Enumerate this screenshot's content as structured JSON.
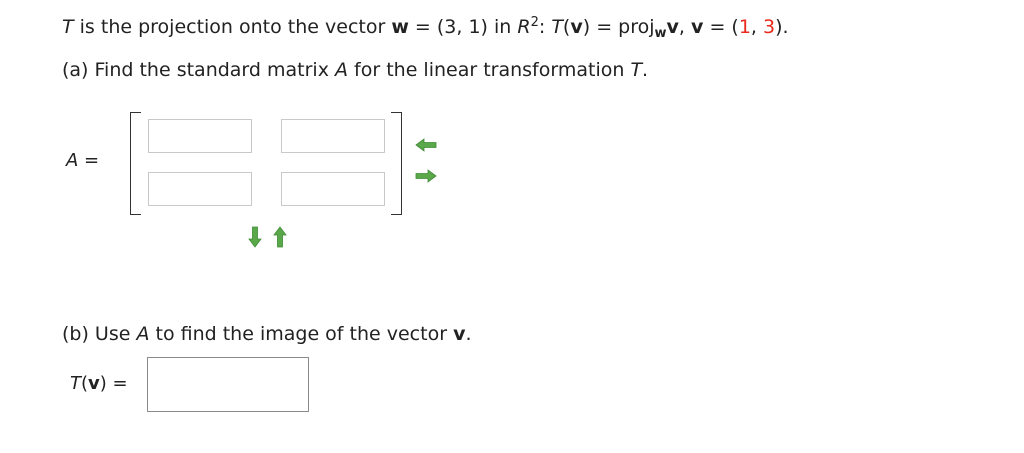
{
  "question": {
    "t_var": "T",
    "intro": " is the projection onto the vector ",
    "w_bold": "w",
    "eq1": " = (3, 1) in ",
    "r_var": "R",
    "r_exp": "2",
    "colon": ": ",
    "t_var2": "T",
    "paren_open": "(",
    "v_bold": "v",
    "paren_close": ")",
    "eq2": " = proj",
    "sub_w": "w",
    "v_bold2": "v",
    "comma_v": ", ",
    "v_bold3": "v",
    "eq3": " = (",
    "v1": "1",
    "sep": ", ",
    "v2": "3",
    "end": ")."
  },
  "part_a": {
    "prefix": "(a) Find the standard matrix ",
    "a_var": "A",
    "middle": " for the linear transformation ",
    "t_var": "T",
    "end": "."
  },
  "matrix": {
    "label_var": "A",
    "label_eq": " =",
    "cells": [
      "",
      "",
      "",
      ""
    ]
  },
  "part_b": {
    "prefix": "(b) Use ",
    "a_var": "A",
    "middle": " to find the image of the vector ",
    "v_bold": "v",
    "end": "."
  },
  "answer": {
    "t_var": "T",
    "paren_open": "(",
    "v_bold": "v",
    "paren_close": ")",
    "eq": " =",
    "value": ""
  },
  "colors": {
    "highlight": "#e8291c",
    "arrow_green": "#5aa84a"
  },
  "icons": [
    "arrow-left-icon",
    "arrow-right-icon",
    "arrow-down-icon",
    "arrow-up-icon"
  ]
}
